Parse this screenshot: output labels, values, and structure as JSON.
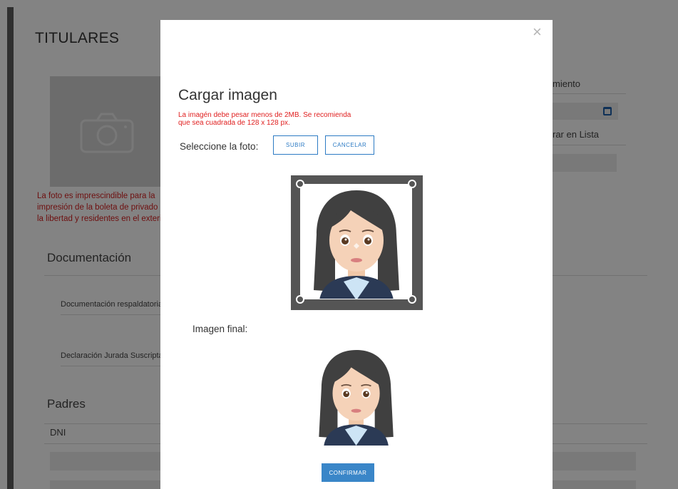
{
  "background": {
    "page_title": "TITULARES",
    "photo_warning": "La foto es imprescindible para la impresión de la boleta de privado de la libertad y residentes en el exterior.",
    "documentacion_title": "Documentación",
    "doc_rows": [
      "Documentación respaldatoria",
      "Declaración Jurada Suscripta"
    ],
    "padres_title": "Padres",
    "dni_label": "DNI",
    "right_labels": [
      "miento",
      "rar en Lista"
    ]
  },
  "modal": {
    "close_glyph": "×",
    "title": "Cargar imagen",
    "warning": "La imagén debe pesar menos de 2MB. Se recomienda que sea cuadrada de 128 x 128 px.",
    "select_label": "Seleccione la foto:",
    "upload_button": "SUBIR",
    "cancel_button": "CANCELAR",
    "final_label": "Imagen final:",
    "confirm_button": "CONFIRMAR"
  },
  "icons": [
    "camera-icon",
    "calendar-icon",
    "close-icon",
    "crop-handle-icon"
  ],
  "colors": {
    "accent": "#2d7bc4",
    "warning": "#e02020",
    "overlay": "#000000"
  }
}
